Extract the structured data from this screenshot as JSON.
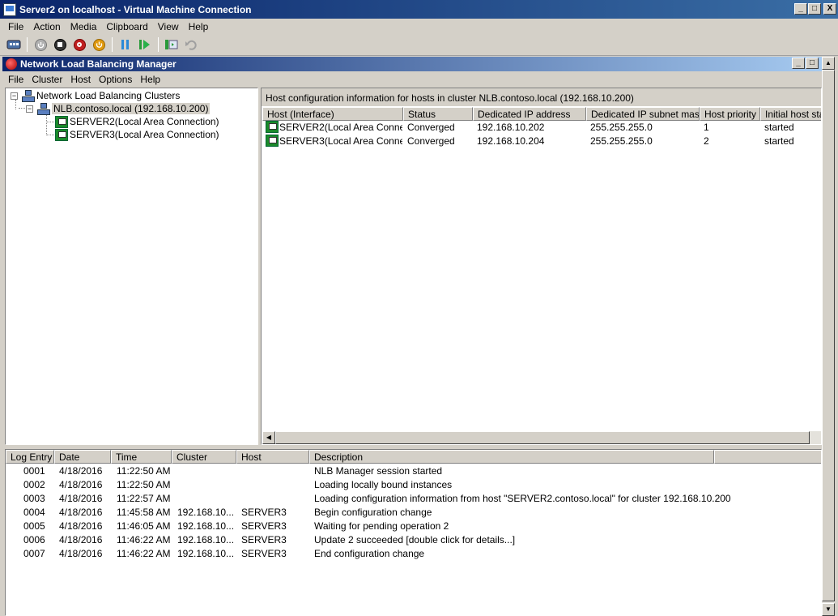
{
  "window": {
    "title": "Server2 on localhost - Virtual Machine Connection",
    "min": "_",
    "max": "□",
    "close": "X"
  },
  "vm_menu": [
    "File",
    "Action",
    "Media",
    "Clipboard",
    "View",
    "Help"
  ],
  "toolbar_icons": [
    "ctrl-alt-del-icon",
    "start-icon",
    "turn-off-icon",
    "shutdown-icon",
    "save-icon",
    "pause-icon",
    "reset-icon",
    "snapshot-icon",
    "revert-icon"
  ],
  "nlb": {
    "title": "Network Load Balancing Manager",
    "menu": [
      "File",
      "Cluster",
      "Host",
      "Options",
      "Help"
    ],
    "tree": {
      "root": "Network Load Balancing Clusters",
      "cluster": "NLB.contoso.local (192.168.10.200)",
      "hosts": [
        "SERVER2(Local Area Connection)",
        "SERVER3(Local Area Connection)"
      ]
    },
    "detail": {
      "caption": "Host configuration information for hosts in cluster NLB.contoso.local (192.168.10.200)",
      "headers": [
        "Host (Interface)",
        "Status",
        "Dedicated IP address",
        "Dedicated IP subnet mask",
        "Host priority",
        "Initial host state"
      ],
      "rows": [
        [
          "SERVER2(Local Area Conne...",
          "Converged",
          "192.168.10.202",
          "255.255.255.0",
          "1",
          "started"
        ],
        [
          "SERVER3(Local Area Conne...",
          "Converged",
          "192.168.10.204",
          "255.255.255.0",
          "2",
          "started"
        ]
      ]
    },
    "log": {
      "headers": [
        "Log Entry",
        "Date",
        "Time",
        "Cluster",
        "Host",
        "Description"
      ],
      "rows": [
        [
          "0001",
          "4/18/2016",
          "11:22:50 AM",
          "",
          "",
          "NLB Manager session started"
        ],
        [
          "0002",
          "4/18/2016",
          "11:22:50 AM",
          "",
          "",
          "Loading locally bound instances"
        ],
        [
          "0003",
          "4/18/2016",
          "11:22:57 AM",
          "",
          "",
          "Loading configuration information from host \"SERVER2.contoso.local\" for cluster 192.168.10.200"
        ],
        [
          "0004",
          "4/18/2016",
          "11:45:58 AM",
          "192.168.10...",
          "SERVER3",
          "Begin configuration change"
        ],
        [
          "0005",
          "4/18/2016",
          "11:46:05 AM",
          "192.168.10...",
          "SERVER3",
          "Waiting for pending operation 2"
        ],
        [
          "0006",
          "4/18/2016",
          "11:46:22 AM",
          "192.168.10...",
          "SERVER3",
          "Update 2 succeeded [double click for details...]"
        ],
        [
          "0007",
          "4/18/2016",
          "11:46:22 AM",
          "192.168.10...",
          "SERVER3",
          "End configuration change"
        ]
      ]
    }
  }
}
